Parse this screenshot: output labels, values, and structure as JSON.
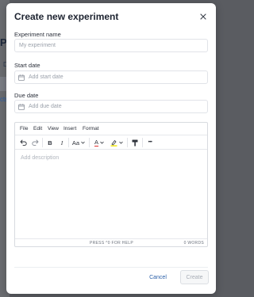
{
  "background": {
    "title_fragment": "Pr",
    "d_fragment": "D",
    "link_fragment": "cts"
  },
  "modal": {
    "title": "Create new experiment",
    "close_icon": "close-icon"
  },
  "form": {
    "name_label": "Experiment name",
    "name_placeholder": "My experiment",
    "start_label": "Start date",
    "start_placeholder": "Add start date",
    "due_label": "Due date",
    "due_placeholder": "Add due date",
    "calendar_icon": "calendar-icon"
  },
  "editor": {
    "menu": [
      "File",
      "Edit",
      "View",
      "Insert",
      "Format"
    ],
    "toolbar": {
      "undo_icon": "undo-icon",
      "redo_icon": "redo-icon",
      "bold": "B",
      "italic": "I",
      "font_size": "Aa",
      "text_color": "A",
      "highlight_icon": "highlight-icon",
      "format_painter_icon": "paint-roller-icon",
      "more": "•••"
    },
    "placeholder": "Add description",
    "help_text": "PRESS ^0 FOR HELP",
    "word_count": "0 WORDS"
  },
  "footer": {
    "cancel_label": "Cancel",
    "create_label": "Create"
  },
  "colors": {
    "accent": "#2a5fa8",
    "text_color_underline": "#e0312f",
    "highlight_color": "#f2e600"
  }
}
